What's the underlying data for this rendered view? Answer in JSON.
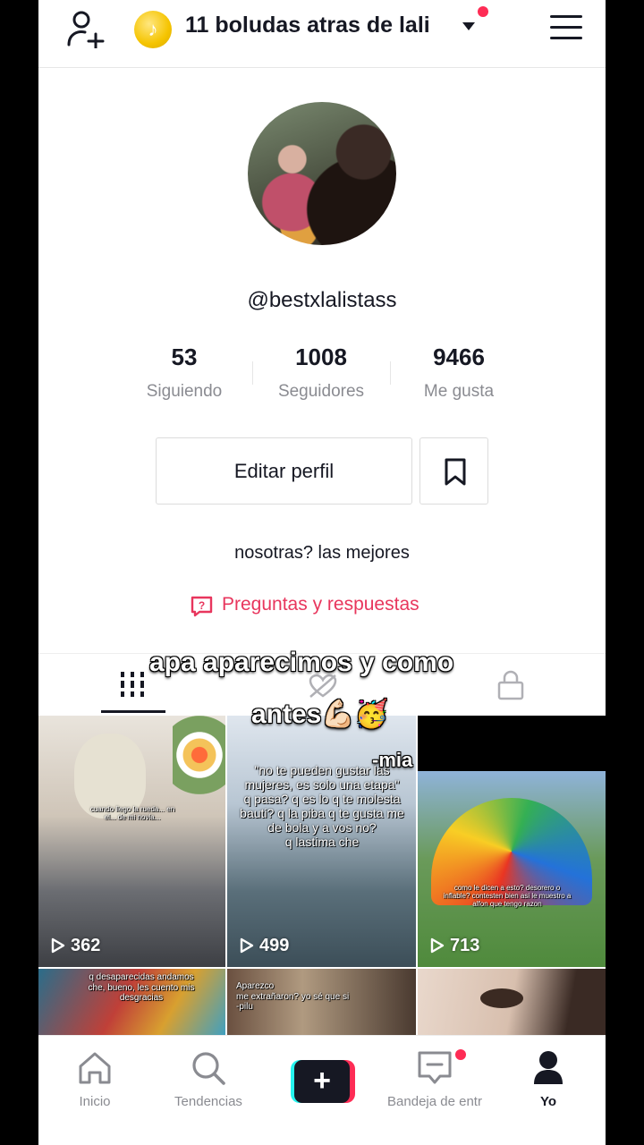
{
  "header": {
    "account_name": "11 boludas atras de lali",
    "coin_glyph": "♪",
    "icons": [
      "add-user-icon",
      "coin-icon",
      "chevron-down-icon",
      "menu-icon"
    ]
  },
  "profile": {
    "username": "@bestxlalistass",
    "stats": [
      {
        "value": "53",
        "label": "Siguiendo"
      },
      {
        "value": "1008",
        "label": "Seguidores"
      },
      {
        "value": "9466",
        "label": "Me gusta"
      }
    ],
    "edit_label": "Editar perfil",
    "bio": "nosotras? las mejores",
    "qa_label": "Preguntas y respuestas"
  },
  "overlay": {
    "line1": "apa aparecimos y como",
    "line2": "antes💪🏻🥳",
    "signature": "-mia"
  },
  "videos": [
    {
      "views": "362",
      "text": "cuando llego la rueda... en el... de mi novia..."
    },
    {
      "views": "499",
      "text": "\"no te pueden gustar las mujeres, es solo una etapa\"\nq pasa? q es lo q te molesta bauti? q la piba q te gusta me de bola y a vos no?\nq lastima che"
    },
    {
      "views": "713",
      "text": "como le dicen a esto? desorero o inflable? contesten bien asi le muestro a alfon que tengo razon"
    },
    {
      "views": "",
      "text": "q desaparecidas andamos che, bueno, les cuento mis desgracias"
    },
    {
      "views": "",
      "text": "Aparezco\nme extrañaron? yo sé que si\n-pilu"
    },
    {
      "views": "",
      "text": ""
    }
  ],
  "bottom_nav": [
    {
      "label": "Inicio",
      "icon": "home-icon"
    },
    {
      "label": "Tendencias",
      "icon": "search-icon"
    },
    {
      "label": "+",
      "icon": "create-icon"
    },
    {
      "label": "Bandeja de entr",
      "icon": "inbox-icon"
    },
    {
      "label": "Yo",
      "icon": "profile-icon"
    }
  ],
  "colors": {
    "accent": "#fe2c55",
    "cyan": "#25f4ee",
    "text": "#161823",
    "muted": "#8a8b91",
    "qa": "#e8365d"
  }
}
